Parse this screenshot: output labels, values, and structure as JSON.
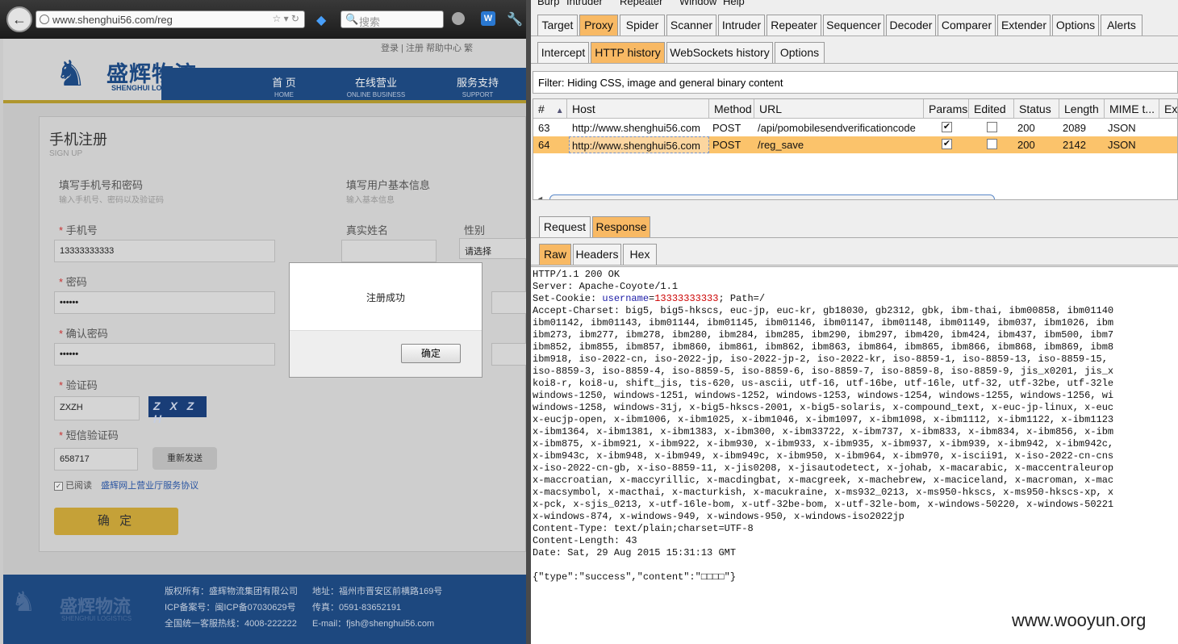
{
  "browser": {
    "url": "www.shenghui56.com/reg",
    "search_placeholder": "搜索"
  },
  "site": {
    "top_links": "登录 | 注册   帮助中心   繁",
    "logo_cn": "盛辉物流",
    "logo_en": "SHENGHUI LOGISTICS",
    "nav": [
      {
        "zh": "首 页",
        "en": "HOME"
      },
      {
        "zh": "在线营业",
        "en": "ONLINE BUSINESS"
      },
      {
        "zh": "服务支持",
        "en": "SUPPORT"
      }
    ],
    "form": {
      "title": "手机注册",
      "subtitle": "SIGN UP",
      "section1_title": "填写手机号和密码",
      "section1_sub": "输入手机号、密码以及验证码",
      "section2_title": "填写用户基本信息",
      "section2_sub": "输入基本信息",
      "phone_label": "手机号",
      "phone_value": "13333333333",
      "password_label": "密码",
      "password_value": "••••••",
      "confirm_label": "确认密码",
      "confirm_value": "••••••",
      "captcha_label": "验证码",
      "captcha_value": "ZXZH",
      "captcha_image_text": "Z X Z H",
      "sms_label": "短信验证码",
      "sms_value": "658717",
      "resend_label": "重新发送",
      "agree_prefix": "已阅读",
      "agree_link": "盛辉网上营业厅服务协议",
      "submit_label": "确 定",
      "realname_label": "真实姓名",
      "gender_label": "性别",
      "gender_value": "请选择",
      "required_mark": "*"
    },
    "footer": {
      "copyright": "版权所有：盛辉物流集团有限公司",
      "icp": "ICP备案号：闽ICP备07030629号",
      "hotline": "全国统一客服热线：4008-222222",
      "address": "地址：福州市晋安区前横路169号",
      "fax": "传真：0591-83652191",
      "email": "E-mail：fjsh@shenghui56.com",
      "logo_cn": "盛辉物流",
      "logo_en": "SHENGHUI LOGISTICS"
    },
    "dialog": {
      "message": "注册成功",
      "ok_label": "确定"
    }
  },
  "burp": {
    "menu": [
      "Burp",
      "Intruder",
      "Repeater",
      "Window",
      "Help"
    ],
    "main_tabs": [
      "Target",
      "Proxy",
      "Spider",
      "Scanner",
      "Intruder",
      "Repeater",
      "Sequencer",
      "Decoder",
      "Comparer",
      "Extender",
      "Options",
      "Alerts"
    ],
    "main_selected": "Proxy",
    "proxy_tabs": [
      "Intercept",
      "HTTP history",
      "WebSockets history",
      "Options"
    ],
    "proxy_selected": "HTTP history",
    "filter": "Filter: Hiding CSS, image and general binary content",
    "columns": [
      "#",
      "Host",
      "Method",
      "URL",
      "Params",
      "Edited",
      "Status",
      "Length",
      "MIME t...",
      "Ext"
    ],
    "sort_arrow": "▲",
    "rows": [
      {
        "num": "63",
        "host": "http://www.shenghui56.com",
        "method": "POST",
        "url": "/api/pomobilesendverificationcode",
        "params": true,
        "edited": false,
        "status": "200",
        "length": "2089",
        "mime": "JSON"
      },
      {
        "num": "64",
        "host": "http://www.shenghui56.com",
        "method": "POST",
        "url": "/reg_save",
        "params": true,
        "edited": false,
        "status": "200",
        "length": "2142",
        "mime": "JSON"
      }
    ],
    "reqresp_tabs": [
      "Request",
      "Response"
    ],
    "reqresp_selected": "Response",
    "view_tabs": [
      "Raw",
      "Headers",
      "Hex"
    ],
    "view_selected": "Raw",
    "raw_lines": [
      "HTTP/1.1 200 OK",
      "Server: Apache-Coyote/1.1",
      "Set-Cookie: username=13333333333; Path=/",
      "Accept-Charset: big5, big5-hkscs, euc-jp, euc-kr, gb18030, gb2312, gbk, ibm-thai, ibm00858, ibm01140",
      "ibm01142, ibm01143, ibm01144, ibm01145, ibm01146, ibm01147, ibm01148, ibm01149, ibm037, ibm1026, ibm",
      "ibm273, ibm277, ibm278, ibm280, ibm284, ibm285, ibm290, ibm297, ibm420, ibm424, ibm437, ibm500, ibm7",
      "ibm852, ibm855, ibm857, ibm860, ibm861, ibm862, ibm863, ibm864, ibm865, ibm866, ibm868, ibm869, ibm8",
      "ibm918, iso-2022-cn, iso-2022-jp, iso-2022-jp-2, iso-2022-kr, iso-8859-1, iso-8859-13, iso-8859-15,",
      "iso-8859-3, iso-8859-4, iso-8859-5, iso-8859-6, iso-8859-7, iso-8859-8, iso-8859-9, jis_x0201, jis_x",
      "koi8-r, koi8-u, shift_jis, tis-620, us-ascii, utf-16, utf-16be, utf-16le, utf-32, utf-32be, utf-32le",
      "windows-1250, windows-1251, windows-1252, windows-1253, windows-1254, windows-1255, windows-1256, wi",
      "windows-1258, windows-31j, x-big5-hkscs-2001, x-big5-solaris, x-compound_text, x-euc-jp-linux, x-euc",
      "x-eucjp-open, x-ibm1006, x-ibm1025, x-ibm1046, x-ibm1097, x-ibm1098, x-ibm1112, x-ibm1122, x-ibm1123",
      "x-ibm1364, x-ibm1381, x-ibm1383, x-ibm300, x-ibm33722, x-ibm737, x-ibm833, x-ibm834, x-ibm856, x-ibm",
      "x-ibm875, x-ibm921, x-ibm922, x-ibm930, x-ibm933, x-ibm935, x-ibm937, x-ibm939, x-ibm942, x-ibm942c,",
      "x-ibm943c, x-ibm948, x-ibm949, x-ibm949c, x-ibm950, x-ibm964, x-ibm970, x-iscii91, x-iso-2022-cn-cns",
      "x-iso-2022-cn-gb, x-iso-8859-11, x-jis0208, x-jisautodetect, x-johab, x-macarabic, x-maccentraleurop",
      "x-maccroatian, x-maccyrillic, x-macdingbat, x-macgreek, x-machebrew, x-maciceland, x-macroman, x-mac",
      "x-macsymbol, x-macthai, x-macturkish, x-macukraine, x-ms932_0213, x-ms950-hkscs, x-ms950-hkscs-xp, x",
      "x-pck, x-sjis_0213, x-utf-16le-bom, x-utf-32be-bom, x-utf-32le-bom, x-windows-50220, x-windows-50221",
      "x-windows-874, x-windows-949, x-windows-950, x-windows-iso2022jp",
      "Content-Type: text/plain;charset=UTF-8",
      "Content-Length: 43",
      "Date: Sat, 29 Aug 2015 15:31:13 GMT",
      "",
      "{\"type\":\"success\",\"content\":\"□□□□\"}"
    ]
  },
  "watermark": "www.wooyun.org"
}
